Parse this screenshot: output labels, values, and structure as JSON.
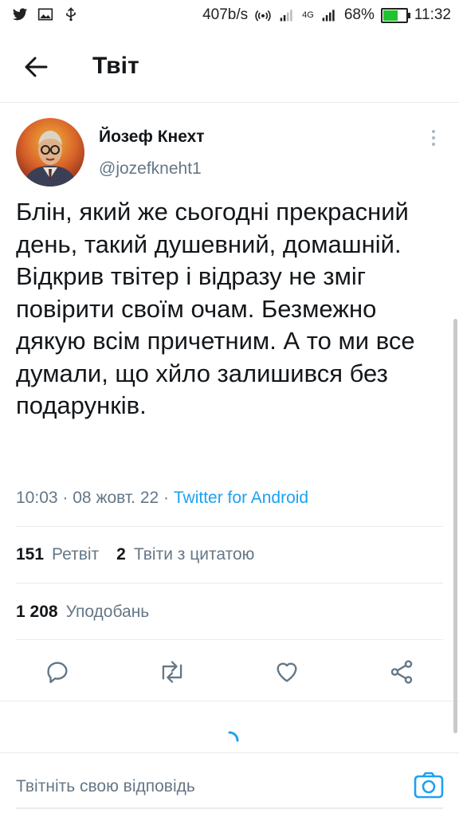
{
  "status_bar": {
    "net_speed": "407b/s",
    "network_type": "4G",
    "battery_percent": "68%",
    "battery_level": 0.68,
    "time": "11:32",
    "left_icons": [
      "twitter-icon",
      "gallery-icon",
      "usb-icon"
    ],
    "right_icons": [
      "hotspot-icon",
      "signal-icon",
      "signal-4g-icon",
      "battery-icon"
    ]
  },
  "header": {
    "title": "Твіт",
    "back_icon": "arrow-left-icon"
  },
  "tweet": {
    "author_name": "Йозеф Кнехт",
    "author_handle": "@jozefkneht1",
    "text": "Блін, який же сьогодні прекрасний день, такий душевний, домашній. Відкрив твітер і відразу не зміг повірити своїм очам. Безмежно дякую всім причетним. А то ми все думали, що хйло залишився без подарунків.",
    "time": "10:03",
    "date": "08 жовт. 22",
    "source": "Twitter for Android",
    "separator": "·"
  },
  "stats": {
    "retweets_count": "151",
    "retweets_label": "Ретвіт",
    "quotes_count": "2",
    "quotes_label": "Твіти з цитатою",
    "likes_count": "1 208",
    "likes_label": "Уподобань"
  },
  "actions": [
    "reply-icon",
    "retweet-icon",
    "like-icon",
    "share-icon"
  ],
  "reply": {
    "placeholder": "Твітніть свою відповідь",
    "camera_icon": "camera-icon"
  },
  "colors": {
    "accent": "#1da1f2",
    "text_primary": "#14171a",
    "text_secondary": "#657786",
    "divider": "#e6ecf0"
  }
}
